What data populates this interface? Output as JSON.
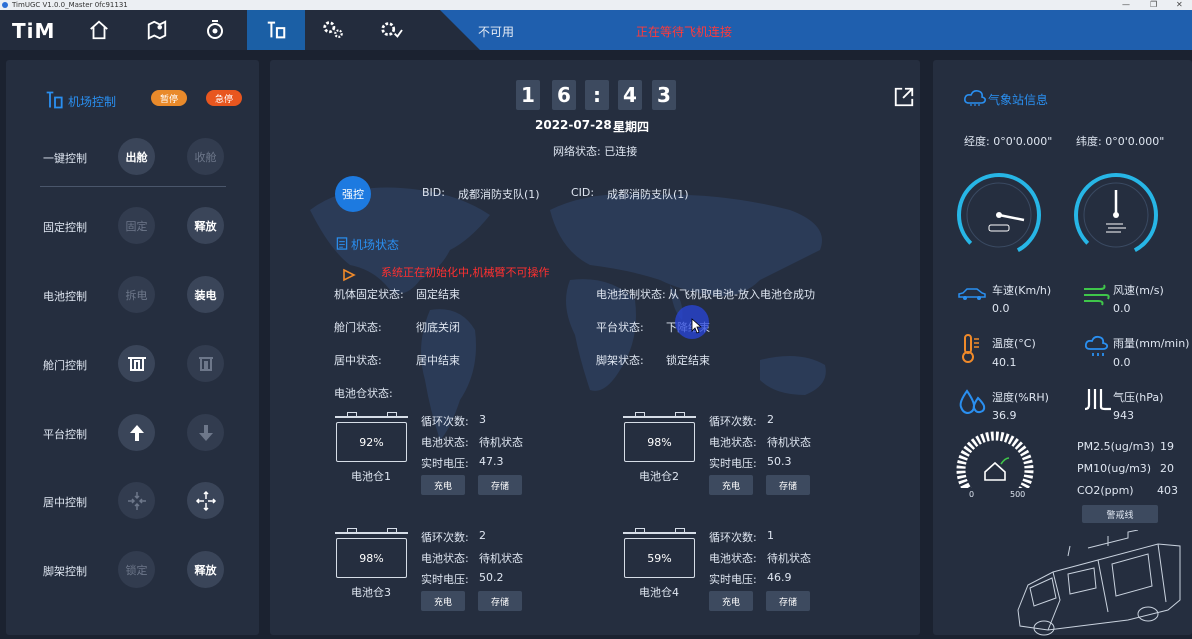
{
  "window": {
    "title": "TimUGC V1.0.0_Master 0fc91131"
  },
  "nav": {
    "logo": "TiM",
    "items": [
      "home-icon",
      "map-icon",
      "drone-icon",
      "airport-icon",
      "settings-icon",
      "config-icon"
    ],
    "active_index": 3,
    "status_unavailable": "不可用",
    "status_waiting": "正在等待飞机连接"
  },
  "left": {
    "title": "机场控制",
    "pause": "暂停",
    "emergency": "急停",
    "rows": [
      {
        "label": "一键控制",
        "a": "出舱",
        "b": "收舱",
        "a_enabled": true,
        "b_enabled": false
      },
      {
        "label": "固定控制",
        "a": "固定",
        "b": "释放",
        "a_enabled": false,
        "b_enabled": true
      },
      {
        "label": "电池控制",
        "a": "拆电",
        "b": "装电",
        "a_enabled": false,
        "b_enabled": true
      },
      {
        "label": "舱门控制",
        "a": "",
        "b": "",
        "a_enabled": true,
        "b_enabled": false
      },
      {
        "label": "平台控制",
        "a": "",
        "b": "",
        "a_enabled": true,
        "b_enabled": false
      },
      {
        "label": "居中控制",
        "a": "",
        "b": "",
        "a_enabled": false,
        "b_enabled": true
      },
      {
        "label": "脚架控制",
        "a": "锁定",
        "b": "释放",
        "a_enabled": false,
        "b_enabled": true
      }
    ]
  },
  "center": {
    "clock": [
      "1",
      "6",
      ":",
      "4",
      "3"
    ],
    "date": "2022-07-28",
    "weekday": "星期四",
    "network": "网络状态: 已连接",
    "force": "强控",
    "bid_label": "BID:",
    "bid_value": "成都消防支队(1)",
    "cid_label": "CID:",
    "cid_value": "成都消防支队(1)",
    "section_title": "机场状态",
    "warning": "系统正在初始化中,机械臂不可操作",
    "status": [
      {
        "label": "机体固定状态:",
        "value": "固定结束"
      },
      {
        "label": "电池控制状态:",
        "value": "从飞机取电池-放入电池仓成功"
      },
      {
        "label": "舱门状态:",
        "value": "彻底关闭"
      },
      {
        "label": "平台状态:",
        "value": "下降结束"
      },
      {
        "label": "居中状态:",
        "value": "居中结束"
      },
      {
        "label": "脚架状态:",
        "value": "锁定结束"
      }
    ],
    "battery_title": "电池仓状态:",
    "cycle_label": "循环次数:",
    "state_label": "电池状态:",
    "voltage_label": "实时电压:",
    "charge_label": "充电",
    "store_label": "存储",
    "batteries": [
      {
        "name": "电池仓1",
        "percent": "92%",
        "cycles": "3",
        "state": "待机状态",
        "voltage": "47.3"
      },
      {
        "name": "电池仓2",
        "percent": "98%",
        "cycles": "2",
        "state": "待机状态",
        "voltage": "50.3"
      },
      {
        "name": "电池仓3",
        "percent": "98%",
        "cycles": "2",
        "state": "待机状态",
        "voltage": "50.2"
      },
      {
        "name": "电池仓4",
        "percent": "59%",
        "cycles": "1",
        "state": "待机状态",
        "voltage": "46.9"
      }
    ]
  },
  "weather": {
    "title": "气象站信息",
    "longitude": "经度: 0°0'0.000\"",
    "latitude": "纬度: 0°0'0.000\"",
    "speed_label": "车速(Km/h)",
    "speed": "0.0",
    "wind_label": "风速(m/s)",
    "wind": "0.0",
    "temp_label": "温度(°C)",
    "temp": "40.1",
    "rain_label": "雨量(mm/min)",
    "rain": "0.0",
    "humidity_label": "湿度(%RH)",
    "humidity": "36.9",
    "pressure_label": "气压(hPa)",
    "pressure": "943",
    "aqi_min": "0",
    "aqi_max": "500",
    "pm25_label": "PM2.5(ug/m3)",
    "pm25": "19",
    "pm10_label": "PM10(ug/m3)",
    "pm10": "20",
    "co2_label": "CO2(ppm)",
    "co2": "403",
    "alarm_button": "警戒线"
  },
  "colors": {
    "accent": "#1b5fa5",
    "pause": "#e98a2b",
    "emergency": "#e8561f",
    "warning": "#ff3030",
    "cyan": "#27b6e6"
  }
}
